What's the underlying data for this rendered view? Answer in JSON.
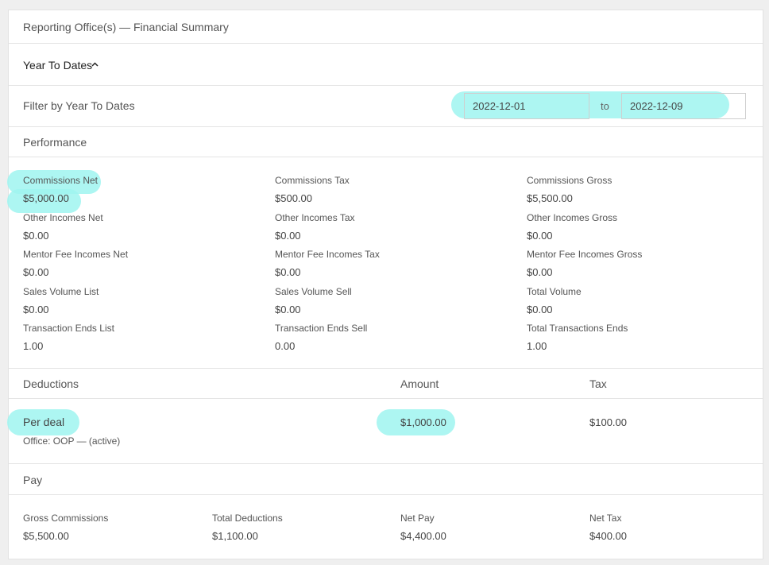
{
  "header": {
    "title": "Reporting Office(s) — Financial Summary"
  },
  "section": {
    "label": "Year To Dates",
    "chevron_icon": "chevron-up-icon"
  },
  "filter": {
    "label": "Filter by Year To Dates",
    "from": "2022-12-01",
    "to_label": "to",
    "to": "2022-12-09"
  },
  "performance": {
    "title": "Performance",
    "items": [
      {
        "label": "Commissions Net",
        "value": "$5,000.00"
      },
      {
        "label": "Commissions Tax",
        "value": "$500.00"
      },
      {
        "label": "Commissions Gross",
        "value": "$5,500.00"
      },
      {
        "label": "Other Incomes Net",
        "value": "$0.00"
      },
      {
        "label": "Other Incomes Tax",
        "value": "$0.00"
      },
      {
        "label": "Other Incomes Gross",
        "value": "$0.00"
      },
      {
        "label": "Mentor Fee Incomes Net",
        "value": "$0.00"
      },
      {
        "label": "Mentor Fee Incomes Tax",
        "value": "$0.00"
      },
      {
        "label": "Mentor Fee Incomes Gross",
        "value": "$0.00"
      },
      {
        "label": "Sales Volume List",
        "value": "$0.00"
      },
      {
        "label": "Sales Volume Sell",
        "value": "$0.00"
      },
      {
        "label": "Total Volume",
        "value": "$0.00"
      },
      {
        "label": "Transaction Ends List",
        "value": "1.00"
      },
      {
        "label": "Transaction Ends Sell",
        "value": "0.00"
      },
      {
        "label": "Total Transactions Ends",
        "value": "1.00"
      }
    ]
  },
  "deductions": {
    "headers": [
      "Deductions",
      "Amount",
      "Tax"
    ],
    "rows": [
      {
        "name": "Per deal",
        "sub": "Office: OOP — (active)",
        "amount": "$1,000.00",
        "tax": "$100.00"
      }
    ]
  },
  "pay": {
    "title": "Pay",
    "items": [
      {
        "label": "Gross Commissions",
        "value": "$5,500.00"
      },
      {
        "label": "Total Deductions",
        "value": "$1,100.00"
      },
      {
        "label": "Net Pay",
        "value": "$4,400.00"
      },
      {
        "label": "Net Tax",
        "value": "$400.00"
      }
    ]
  },
  "colors": {
    "highlight": "#9ff5f0",
    "border": "#e4e4e4"
  }
}
